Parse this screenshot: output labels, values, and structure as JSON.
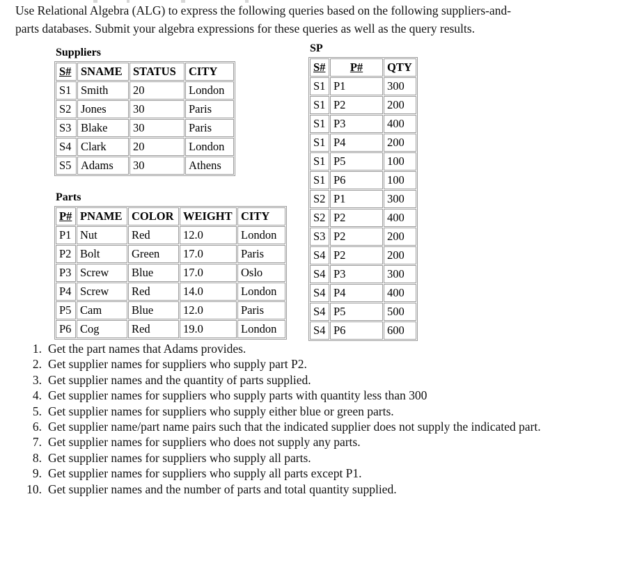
{
  "document": {
    "intro_line1": "Use Relational Algebra (ALG) to express the following queries based on the following suppliers-and-",
    "intro_line2": "parts databases.  Submit your algebra expressions for these queries as well as the query results."
  },
  "suppliers_table": {
    "title": "Suppliers",
    "columns": [
      "S#",
      "SNAME",
      "STATUS",
      "CITY"
    ],
    "rows": [
      [
        "S1",
        "Smith",
        "20",
        "London"
      ],
      [
        "S2",
        "Jones",
        "30",
        "Paris"
      ],
      [
        "S3",
        "Blake",
        "30",
        "Paris"
      ],
      [
        "S4",
        "Clark",
        "20",
        "London"
      ],
      [
        "S5",
        "Adams",
        "30",
        "Athens"
      ]
    ]
  },
  "parts_table": {
    "title": "Parts",
    "columns": [
      "P#",
      "PNAME",
      "COLOR",
      "WEIGHT",
      "CITY"
    ],
    "rows": [
      [
        "P1",
        "Nut",
        "Red",
        "12.0",
        "London"
      ],
      [
        "P2",
        "Bolt",
        "Green",
        "17.0",
        "Paris"
      ],
      [
        "P3",
        "Screw",
        "Blue",
        "17.0",
        "Oslo"
      ],
      [
        "P4",
        "Screw",
        "Red",
        "14.0",
        "London"
      ],
      [
        "P5",
        "Cam",
        "Blue",
        "12.0",
        "Paris"
      ],
      [
        "P6",
        "Cog",
        "Red",
        "19.0",
        "London"
      ]
    ]
  },
  "sp_table": {
    "title": "SP",
    "columns": [
      "S#",
      "P#",
      "QTY"
    ],
    "rows": [
      [
        "S1",
        "P1",
        "300"
      ],
      [
        "S1",
        "P2",
        "200"
      ],
      [
        "S1",
        "P3",
        "400"
      ],
      [
        "S1",
        "P4",
        "200"
      ],
      [
        "S1",
        "P5",
        "100"
      ],
      [
        "S1",
        "P6",
        "100"
      ],
      [
        "S2",
        "P1",
        "300"
      ],
      [
        "S2",
        "P2",
        "400"
      ],
      [
        "S3",
        "P2",
        "200"
      ],
      [
        "S4",
        "P2",
        "200"
      ],
      [
        "S4",
        "P3",
        "300"
      ],
      [
        "S4",
        "P4",
        "400"
      ],
      [
        "S4",
        "P5",
        "500"
      ],
      [
        "S4",
        "P6",
        "600"
      ]
    ]
  },
  "queries": [
    {
      "number": "1.",
      "text": "Get the part names that Adams provides."
    },
    {
      "number": "2.",
      "text": "Get supplier names for suppliers who supply part P2."
    },
    {
      "number": "3.",
      "text": "Get supplier names and the quantity of parts supplied."
    },
    {
      "number": "4.",
      "text": "Get supplier names for suppliers who supply parts with quantity less than 300"
    },
    {
      "number": "5.",
      "text": "Get supplier names for suppliers who supply either blue or green parts."
    },
    {
      "number": "6.",
      "text": "Get supplier name/part name pairs such that the indicated supplier does not supply the indicated part."
    },
    {
      "number": "7.",
      "text": "Get supplier names for suppliers who does not supply any parts."
    },
    {
      "number": "8.",
      "text": "Get supplier names for suppliers who supply all parts."
    },
    {
      "number": "9.",
      "text": "Get supplier names for suppliers who supply all parts except P1."
    },
    {
      "number": "10.",
      "text": "Get supplier names and the number of parts and total quantity supplied."
    }
  ]
}
